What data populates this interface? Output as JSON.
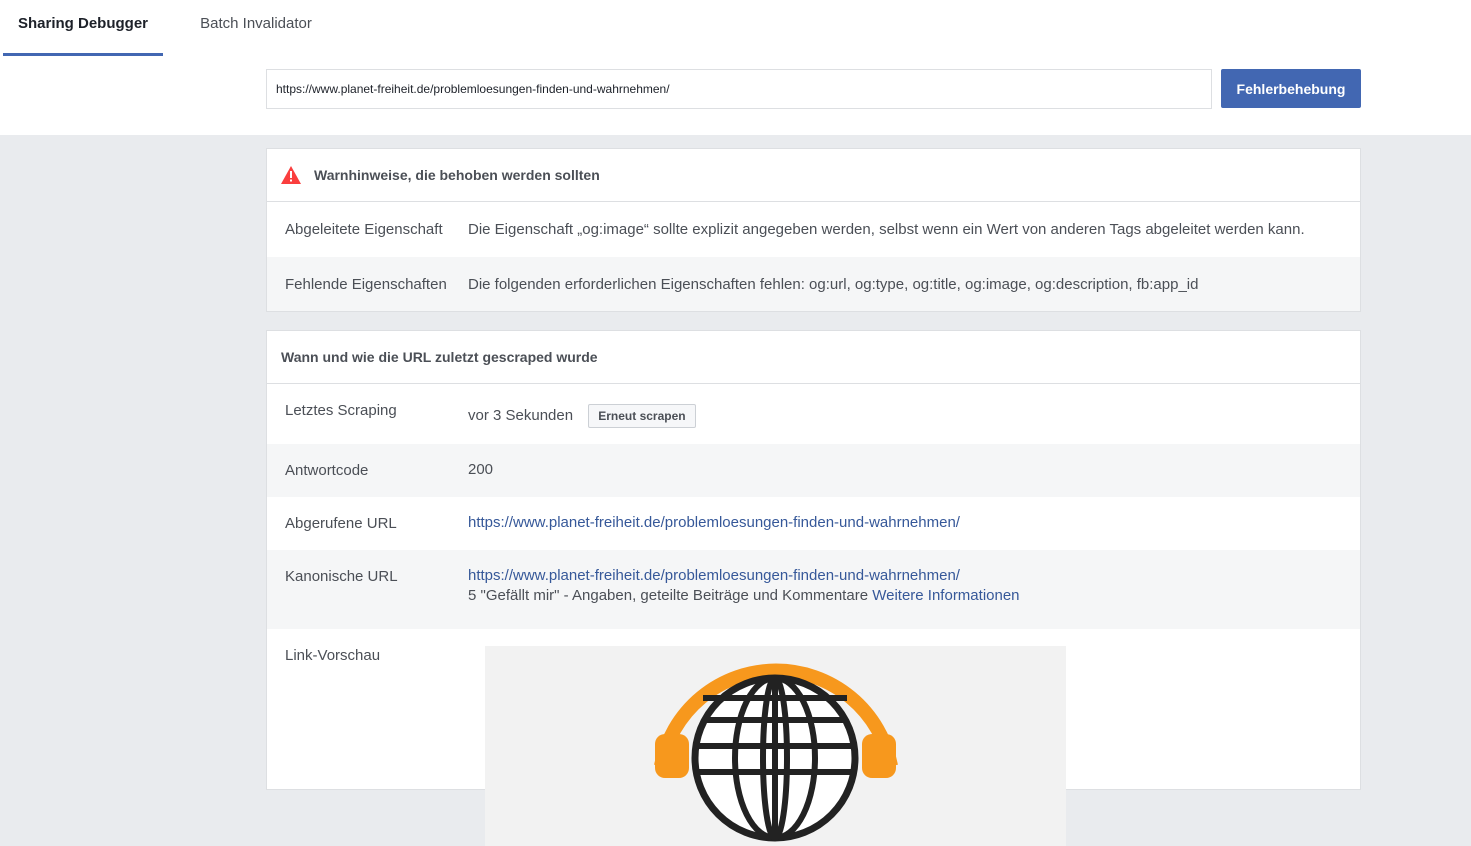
{
  "tabs": [
    {
      "label": "Sharing Debugger",
      "active": true
    },
    {
      "label": "Batch Invalidator",
      "active": false
    }
  ],
  "search": {
    "value": "https://www.planet-freiheit.de/problemloesungen-finden-und-wahrnehmen/",
    "button_label": "Fehlerbehebung"
  },
  "warnings": {
    "title": "Warnhinweise, die behoben werden sollten",
    "icon": "warning-triangle-icon",
    "rows": [
      {
        "label": "Abgeleitete Eigenschaft",
        "value": "Die Eigenschaft „og:image“ sollte explizit angegeben werden, selbst wenn ein Wert von anderen Tags abgeleitet werden kann."
      },
      {
        "label": "Fehlende Eigenschaften",
        "value": "Die folgenden erforderlichen Eigenschaften fehlen: og:url, og:type, og:title, og:image, og:description, fb:app_id"
      }
    ]
  },
  "scrape": {
    "title": "Wann und wie die URL zuletzt gescraped wurde",
    "last_scrape_label": "Letztes Scraping",
    "last_scrape_value": "vor 3 Sekunden",
    "rescrape_button": "Erneut scrapen",
    "response_code_label": "Antwortcode",
    "response_code_value": "200",
    "fetched_url_label": "Abgerufene URL",
    "fetched_url_value": "https://www.planet-freiheit.de/problemloesungen-finden-und-wahrnehmen/",
    "canonical_url_label": "Kanonische URL",
    "canonical_url_value": "https://www.planet-freiheit.de/problemloesungen-finden-und-wahrnehmen/",
    "engagement_text": "5 \"Gefällt mir\" - Angaben, geteilte Beiträge und Kommentare",
    "more_info_link": "Weitere Informationen",
    "link_preview_label": "Link-Vorschau",
    "preview_image": "globe-headphones-logo"
  },
  "colors": {
    "accent": "#4267b2",
    "link": "#365899",
    "warning": "#fa3e3e",
    "logo_orange": "#f7981d",
    "page_bg": "#e9ebee"
  }
}
